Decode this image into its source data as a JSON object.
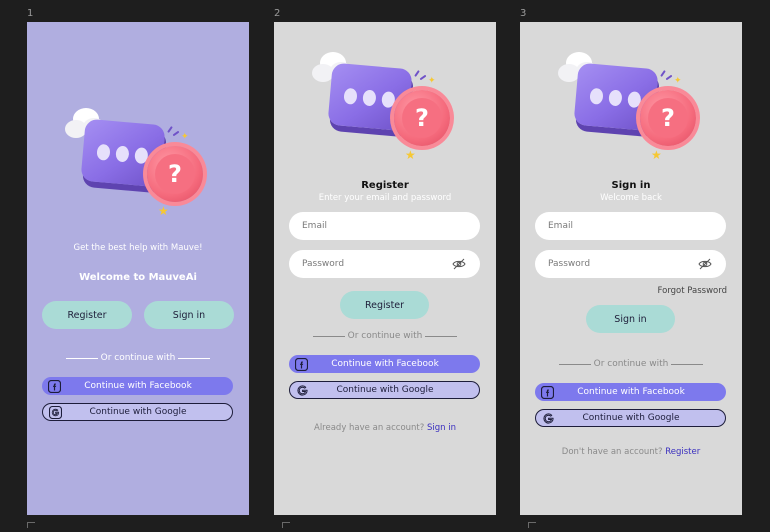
{
  "screens": [
    {
      "index_label": "1",
      "tagline": "Get the best help with Mauve!",
      "welcome": "Welcome to MauveAi",
      "register_label": "Register",
      "signin_label": "Sign in",
      "divider_text": "Or continue with",
      "facebook_label": "Continue with Facebook",
      "google_label": "Continue with Google"
    },
    {
      "index_label": "2",
      "title": "Register",
      "subtitle": "Enter your email and password",
      "email_placeholder": "Email",
      "password_placeholder": "Password",
      "register_label": "Register",
      "divider_text": "Or continue with",
      "facebook_label": "Continue with Facebook",
      "google_label": "Continue with Google",
      "footer_prompt": "Already have an account?",
      "footer_link": "Sign in"
    },
    {
      "index_label": "3",
      "title": "Sign in",
      "subtitle": "Welcome back",
      "email_placeholder": "Email",
      "password_placeholder": "Password",
      "forgot_label": "Forgot Password",
      "signin_label": "Sign in",
      "divider_text": "Or continue with",
      "facebook_label": "Continue with Facebook",
      "google_label": "Continue with Google",
      "footer_prompt": "Don't have an account?",
      "footer_link": "Register"
    }
  ],
  "colors": {
    "canvas": "#1e1e1e",
    "mauve_bg": "#b0aee0",
    "grey_bg": "#d9d9d9",
    "teal_button": "#aadbd6",
    "facebook_button": "#7d79ed",
    "google_button": "#c1c0ee",
    "link": "#3a2fbf"
  },
  "icons": [
    "chat-question-illustration",
    "facebook-icon",
    "google-icon",
    "eye-off-icon"
  ]
}
